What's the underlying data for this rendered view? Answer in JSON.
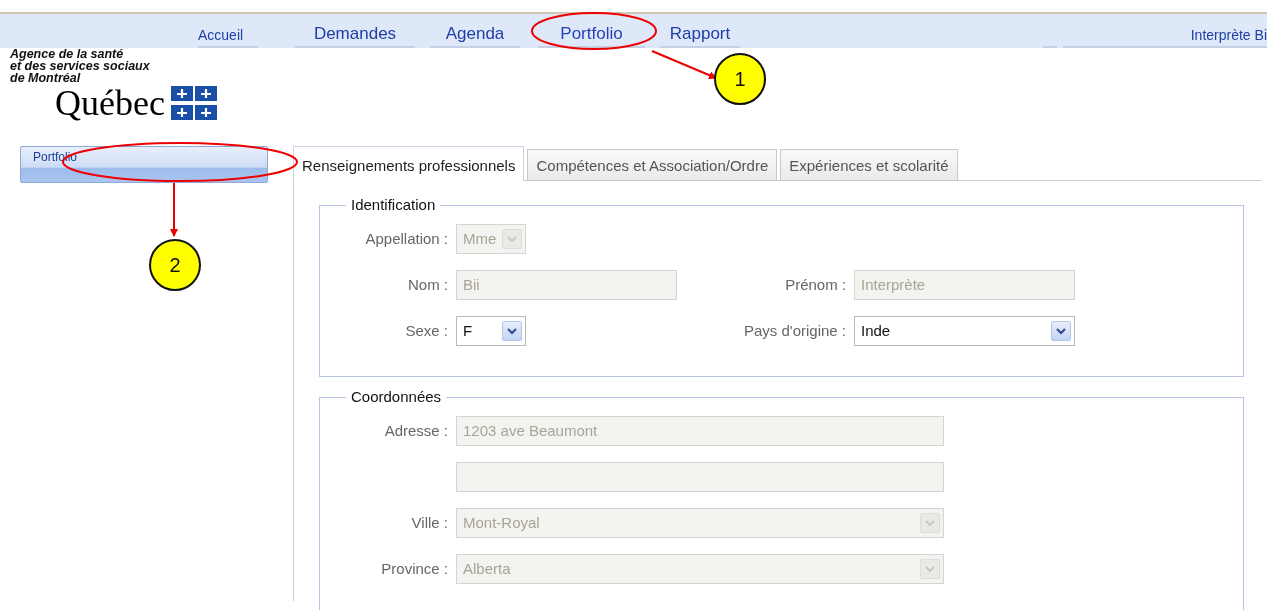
{
  "nav": {
    "items": [
      {
        "label": "Accueil",
        "kind": "home",
        "selected": false
      },
      {
        "label": "Demandes",
        "kind": "menu",
        "selected": false
      },
      {
        "label": "Agenda",
        "kind": "menu",
        "selected": false
      },
      {
        "label": "Portfolio",
        "kind": "menu",
        "selected": true
      },
      {
        "label": "Rapport",
        "kind": "menu",
        "selected": false
      }
    ],
    "user": "Interprète Bi"
  },
  "logo": {
    "lines": [
      "Agence de la santé",
      "et des services sociaux",
      "de Montréal"
    ],
    "wordmark": "Québec"
  },
  "sidebar": {
    "items": [
      {
        "label": "Portfolio",
        "selected": true
      }
    ]
  },
  "tabs": [
    {
      "label": "Renseignements professionnels",
      "selected": true
    },
    {
      "label": "Compétences et Association/Ordre",
      "selected": false
    },
    {
      "label": "Expériences et scolarité",
      "selected": false
    }
  ],
  "sections": [
    {
      "title": "Identification",
      "rows": [
        [
          {
            "label": "Appellation :",
            "kind": "select",
            "value": "Mme",
            "disabled": true
          }
        ],
        [
          {
            "label": "Nom :",
            "kind": "text",
            "value": "Bii",
            "disabled": true
          },
          {
            "label": "Prénom :",
            "kind": "text",
            "value": "Interprète",
            "disabled": true
          }
        ],
        [
          {
            "label": "Sexe :",
            "kind": "select",
            "value": "F",
            "disabled": false
          },
          {
            "label": "Pays d'origine :",
            "kind": "select",
            "value": "Inde",
            "disabled": false
          }
        ]
      ]
    },
    {
      "title": "Coordonnées",
      "rows": [
        [
          {
            "label": "Adresse :",
            "kind": "text",
            "value": "1203 ave Beaumont",
            "disabled": true
          }
        ],
        [
          {
            "kind": "text",
            "disabled": true
          }
        ],
        [
          {
            "label": "Ville :",
            "kind": "select",
            "value": "Mont-Royal",
            "disabled": true
          }
        ],
        [
          {
            "label": "Province :",
            "kind": "select",
            "value": "Alberta",
            "disabled": true
          }
        ]
      ]
    }
  ],
  "callouts": [
    {
      "number": "1"
    },
    {
      "number": "2"
    }
  ]
}
